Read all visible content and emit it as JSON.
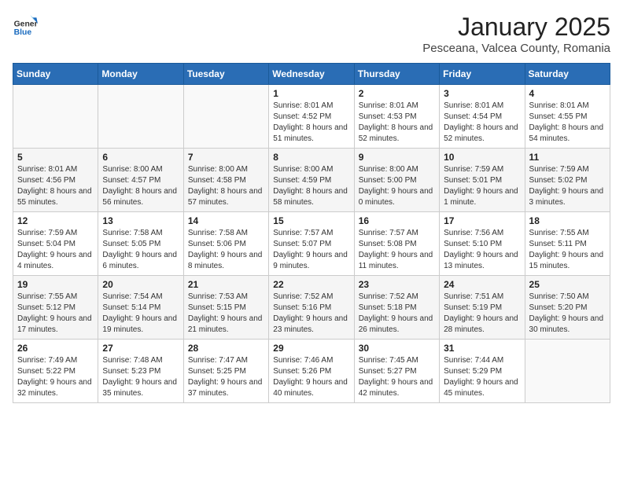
{
  "header": {
    "logo_general": "General",
    "logo_blue": "Blue",
    "month_title": "January 2025",
    "location": "Pesceana, Valcea County, Romania"
  },
  "weekdays": [
    "Sunday",
    "Monday",
    "Tuesday",
    "Wednesday",
    "Thursday",
    "Friday",
    "Saturday"
  ],
  "weeks": [
    [
      {
        "day": "",
        "info": ""
      },
      {
        "day": "",
        "info": ""
      },
      {
        "day": "",
        "info": ""
      },
      {
        "day": "1",
        "info": "Sunrise: 8:01 AM\nSunset: 4:52 PM\nDaylight: 8 hours and 51 minutes."
      },
      {
        "day": "2",
        "info": "Sunrise: 8:01 AM\nSunset: 4:53 PM\nDaylight: 8 hours and 52 minutes."
      },
      {
        "day": "3",
        "info": "Sunrise: 8:01 AM\nSunset: 4:54 PM\nDaylight: 8 hours and 52 minutes."
      },
      {
        "day": "4",
        "info": "Sunrise: 8:01 AM\nSunset: 4:55 PM\nDaylight: 8 hours and 54 minutes."
      }
    ],
    [
      {
        "day": "5",
        "info": "Sunrise: 8:01 AM\nSunset: 4:56 PM\nDaylight: 8 hours and 55 minutes."
      },
      {
        "day": "6",
        "info": "Sunrise: 8:00 AM\nSunset: 4:57 PM\nDaylight: 8 hours and 56 minutes."
      },
      {
        "day": "7",
        "info": "Sunrise: 8:00 AM\nSunset: 4:58 PM\nDaylight: 8 hours and 57 minutes."
      },
      {
        "day": "8",
        "info": "Sunrise: 8:00 AM\nSunset: 4:59 PM\nDaylight: 8 hours and 58 minutes."
      },
      {
        "day": "9",
        "info": "Sunrise: 8:00 AM\nSunset: 5:00 PM\nDaylight: 9 hours and 0 minutes."
      },
      {
        "day": "10",
        "info": "Sunrise: 7:59 AM\nSunset: 5:01 PM\nDaylight: 9 hours and 1 minute."
      },
      {
        "day": "11",
        "info": "Sunrise: 7:59 AM\nSunset: 5:02 PM\nDaylight: 9 hours and 3 minutes."
      }
    ],
    [
      {
        "day": "12",
        "info": "Sunrise: 7:59 AM\nSunset: 5:04 PM\nDaylight: 9 hours and 4 minutes."
      },
      {
        "day": "13",
        "info": "Sunrise: 7:58 AM\nSunset: 5:05 PM\nDaylight: 9 hours and 6 minutes."
      },
      {
        "day": "14",
        "info": "Sunrise: 7:58 AM\nSunset: 5:06 PM\nDaylight: 9 hours and 8 minutes."
      },
      {
        "day": "15",
        "info": "Sunrise: 7:57 AM\nSunset: 5:07 PM\nDaylight: 9 hours and 9 minutes."
      },
      {
        "day": "16",
        "info": "Sunrise: 7:57 AM\nSunset: 5:08 PM\nDaylight: 9 hours and 11 minutes."
      },
      {
        "day": "17",
        "info": "Sunrise: 7:56 AM\nSunset: 5:10 PM\nDaylight: 9 hours and 13 minutes."
      },
      {
        "day": "18",
        "info": "Sunrise: 7:55 AM\nSunset: 5:11 PM\nDaylight: 9 hours and 15 minutes."
      }
    ],
    [
      {
        "day": "19",
        "info": "Sunrise: 7:55 AM\nSunset: 5:12 PM\nDaylight: 9 hours and 17 minutes."
      },
      {
        "day": "20",
        "info": "Sunrise: 7:54 AM\nSunset: 5:14 PM\nDaylight: 9 hours and 19 minutes."
      },
      {
        "day": "21",
        "info": "Sunrise: 7:53 AM\nSunset: 5:15 PM\nDaylight: 9 hours and 21 minutes."
      },
      {
        "day": "22",
        "info": "Sunrise: 7:52 AM\nSunset: 5:16 PM\nDaylight: 9 hours and 23 minutes."
      },
      {
        "day": "23",
        "info": "Sunrise: 7:52 AM\nSunset: 5:18 PM\nDaylight: 9 hours and 26 minutes."
      },
      {
        "day": "24",
        "info": "Sunrise: 7:51 AM\nSunset: 5:19 PM\nDaylight: 9 hours and 28 minutes."
      },
      {
        "day": "25",
        "info": "Sunrise: 7:50 AM\nSunset: 5:20 PM\nDaylight: 9 hours and 30 minutes."
      }
    ],
    [
      {
        "day": "26",
        "info": "Sunrise: 7:49 AM\nSunset: 5:22 PM\nDaylight: 9 hours and 32 minutes."
      },
      {
        "day": "27",
        "info": "Sunrise: 7:48 AM\nSunset: 5:23 PM\nDaylight: 9 hours and 35 minutes."
      },
      {
        "day": "28",
        "info": "Sunrise: 7:47 AM\nSunset: 5:25 PM\nDaylight: 9 hours and 37 minutes."
      },
      {
        "day": "29",
        "info": "Sunrise: 7:46 AM\nSunset: 5:26 PM\nDaylight: 9 hours and 40 minutes."
      },
      {
        "day": "30",
        "info": "Sunrise: 7:45 AM\nSunset: 5:27 PM\nDaylight: 9 hours and 42 minutes."
      },
      {
        "day": "31",
        "info": "Sunrise: 7:44 AM\nSunset: 5:29 PM\nDaylight: 9 hours and 45 minutes."
      },
      {
        "day": "",
        "info": ""
      }
    ]
  ]
}
